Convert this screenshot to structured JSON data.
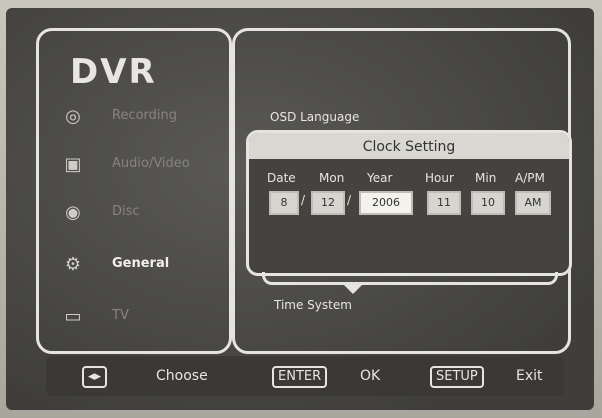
{
  "app": {
    "logo": "DVR"
  },
  "menu": {
    "items": [
      {
        "label": "Recording",
        "icon": "recording-icon",
        "glyph": "◎"
      },
      {
        "label": "Audio/Video",
        "icon": "audio-video-icon",
        "glyph": "▣"
      },
      {
        "label": "Disc",
        "icon": "disc-icon",
        "glyph": "◉"
      },
      {
        "label": "General",
        "icon": "general-settings-icon",
        "glyph": "⚙"
      },
      {
        "label": "TV",
        "icon": "tv-icon",
        "glyph": "▭"
      }
    ],
    "active": "General"
  },
  "settings": {
    "osd_language_label": "OSD Language",
    "time_system_label": "Time System"
  },
  "clock": {
    "title": "Clock Setting",
    "columns": [
      "Date",
      "Mon",
      "Year",
      "Hour",
      "Min",
      "A/PM"
    ],
    "values": {
      "date": "8",
      "mon": "12",
      "year": "2006",
      "hour": "11",
      "min": "10",
      "ampm": "AM"
    },
    "separator": "/"
  },
  "footer": {
    "choose_key": "◂▸",
    "choose_label": "Choose",
    "enter_key": "ENTER",
    "enter_label": "OK",
    "setup_key": "SETUP",
    "setup_label": "Exit"
  }
}
